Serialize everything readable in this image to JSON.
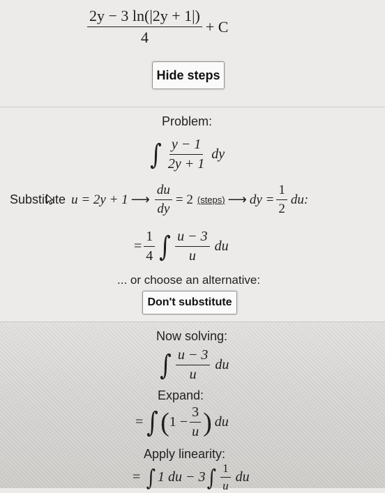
{
  "result": {
    "numerator": "2y − 3 ln(|2y + 1|)",
    "denominator": "4",
    "constant": "+ C"
  },
  "hide_steps_button": "Hide steps",
  "problem": {
    "label": "Problem:",
    "integrand_num": "y − 1",
    "integrand_den": "2y + 1",
    "differential": "dy"
  },
  "substitution": {
    "prefix": "Substitute",
    "u_def": "u = 2y + 1",
    "arrow": "⟶",
    "deriv_num": "du",
    "deriv_den": "dy",
    "deriv_value": "= 2",
    "steps_link": "(steps)",
    "arrow2": "⟶",
    "dy_eq": "dy =",
    "half_num": "1",
    "half_den": "2",
    "du_colon": "du:"
  },
  "substituted": {
    "equals": "=",
    "coef_num": "1",
    "coef_den": "4",
    "integrand_num": "u − 3",
    "integrand_den": "u",
    "differential": "du"
  },
  "alternative_text": "... or choose an alternative:",
  "dont_substitute_button": "Don't substitute",
  "now_solving": {
    "label": "Now solving:",
    "integrand_num": "u − 3",
    "integrand_den": "u",
    "differential": "du"
  },
  "expand": {
    "label": "Expand:",
    "equals": "=",
    "open": "(",
    "one_minus": "1 −",
    "frac_num": "3",
    "frac_den": "u",
    "close": ")",
    "differential": "du"
  },
  "linearity": {
    "label": "Apply linearity:",
    "equals": "=",
    "first": "1 du − 3",
    "frac_num": "1",
    "frac_den": "u",
    "differential": "du"
  }
}
